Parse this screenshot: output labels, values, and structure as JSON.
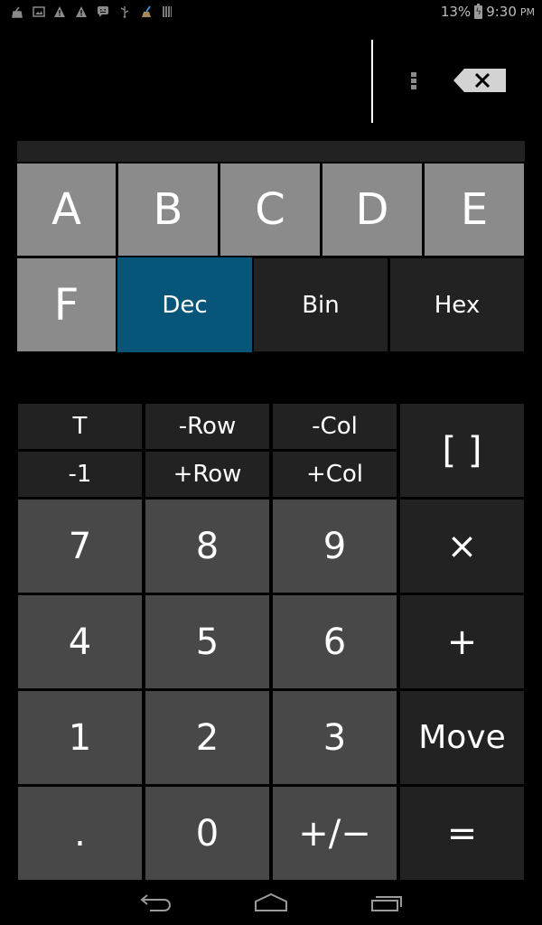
{
  "status_bar": {
    "left_icons": [
      "app-notification-icon",
      "image-icon",
      "warning-icon",
      "warning-icon",
      "chat-icon",
      "usb-icon",
      "cleaner-broom-icon",
      "barcode-icon"
    ],
    "battery_percent": "13%",
    "time": "9:30",
    "ampm": "PM"
  },
  "display": {
    "value": "",
    "overflow_icon": "overflow-menu-icon",
    "backspace_icon": "backspace-icon"
  },
  "hex_keys": [
    "A",
    "B",
    "C",
    "D",
    "E",
    "F"
  ],
  "modes": {
    "items": [
      "Dec",
      "Bin",
      "Hex"
    ],
    "selected": "Dec",
    "active_color": "#08557a"
  },
  "matrix_keys": {
    "transpose": "T",
    "remove_row": "-Row",
    "remove_col": "-Col",
    "inverse": "-1",
    "add_row": "+Row",
    "add_col": "+Col",
    "matrix": "[ ]"
  },
  "keypad": {
    "rows": [
      [
        "7",
        "8",
        "9",
        "×"
      ],
      [
        "4",
        "5",
        "6",
        "+"
      ],
      [
        "1",
        "2",
        "3",
        "Move"
      ],
      [
        ".",
        "0",
        "+/−",
        "="
      ]
    ]
  },
  "nav_bar": {
    "back": "back-icon",
    "home": "home-icon",
    "recents": "recents-icon"
  },
  "colors": {
    "hex_key_bg": "#8b8b8b",
    "digit_key_bg": "#484848",
    "function_key_bg": "#222222"
  }
}
